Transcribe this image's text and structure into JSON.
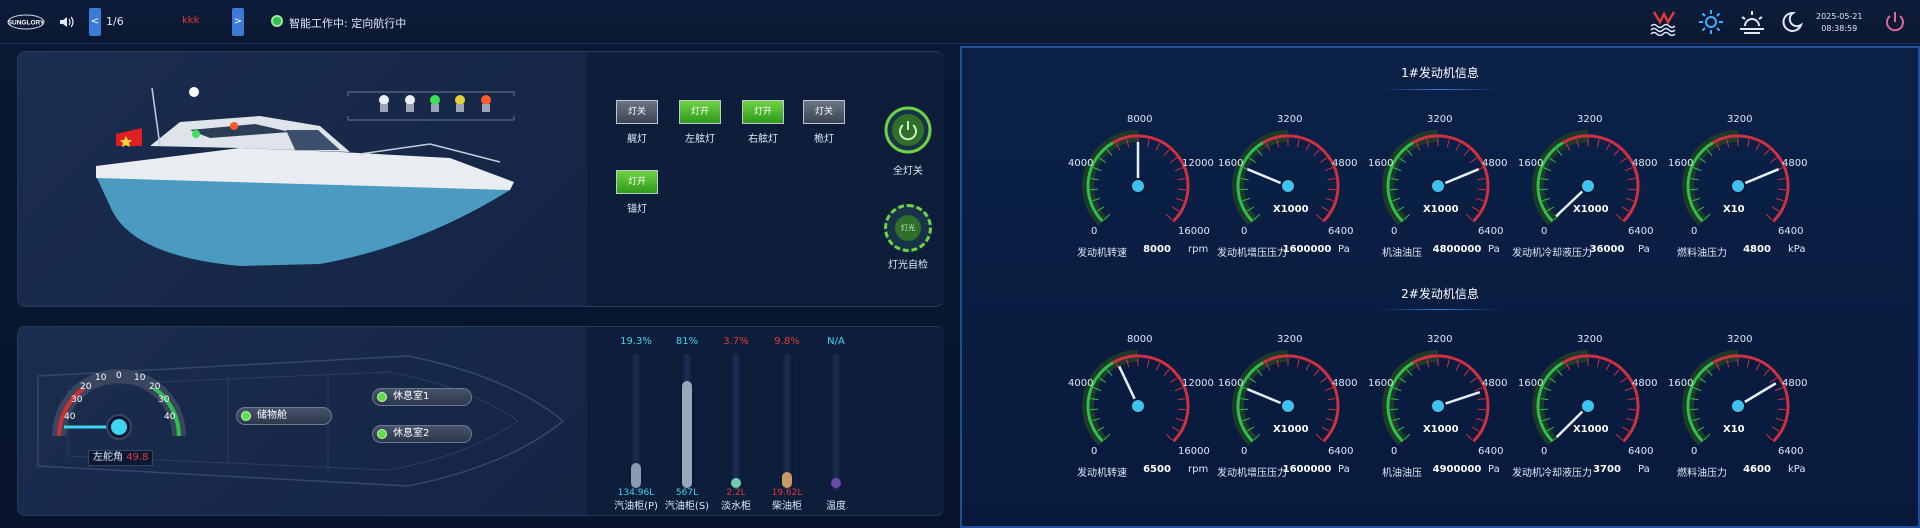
{
  "topbar": {
    "logo_text": "SUNGLORY",
    "page": "1/6",
    "prev_label": "<",
    "next_label": ">",
    "alert_text": "kkk",
    "status_text": "智能工作中: 定向航行中",
    "date": "2025-05-21",
    "time": "08:38:59"
  },
  "lights": {
    "buttons": [
      {
        "state_label": "灯关",
        "label": "艉灯",
        "on": false
      },
      {
        "state_label": "灯开",
        "label": "左舷灯",
        "on": true
      },
      {
        "state_label": "灯开",
        "label": "右舷灯",
        "on": true
      },
      {
        "state_label": "灯关",
        "label": "桅灯",
        "on": false
      },
      {
        "state_label": "灯开",
        "label": "锚灯",
        "on": true
      }
    ],
    "all_off_label": "全灯关",
    "self_check_label": "灯光自检",
    "self_check_inner": "灯光"
  },
  "rudder": {
    "label": "左舵角",
    "value": "49.8",
    "ticks": [
      "40",
      "30",
      "20",
      "10",
      "0",
      "10",
      "20",
      "30",
      "40"
    ]
  },
  "rooms": [
    "储物舱",
    "休息室1",
    "休息室2"
  ],
  "tanks": [
    {
      "pct": "19.3%",
      "value": "134.96L",
      "label": "汽油柜(P)",
      "level": 0.193,
      "pct_color": "#3fd4ef",
      "fill": "#8c9ab0"
    },
    {
      "pct": "81%",
      "value": "567L",
      "label": "汽油柜(S)",
      "level": 0.81,
      "pct_color": "#3fd4ef",
      "fill": "#9aa6ba"
    },
    {
      "pct": "3.7%",
      "value": "2.2L",
      "label": "淡水柜",
      "level": 0.07,
      "pct_color": "#e03a3a",
      "fill": "#6fd0b0"
    },
    {
      "pct": "9.8%",
      "value": "19.62L",
      "label": "柴油柜",
      "level": 0.12,
      "pct_color": "#e03a3a",
      "fill": "#c89a68"
    },
    {
      "pct": "N/A",
      "value": "",
      "label": "温度",
      "level": 0.07,
      "pct_color": "#3fd4ef",
      "fill": "#6a4aa8"
    }
  ],
  "engines": [
    {
      "title": "1#发动机信息",
      "gauges": [
        {
          "label": "发动机转速",
          "value": "8000",
          "unit": "rpm",
          "min": "0",
          "left": "4000",
          "top": "8000",
          "right": "12000",
          "max": "16000",
          "mult": "",
          "reading": 8000,
          "range_max": 16000
        },
        {
          "label": "发动机增压压力",
          "value": "1600000",
          "unit": "Pa",
          "min": "0",
          "left": "1600",
          "top": "3200",
          "right": "4800",
          "max": "6400",
          "mult": "X1000",
          "reading": 1600,
          "range_max": 6400
        },
        {
          "label": "机油油压",
          "value": "4800000",
          "unit": "Pa",
          "min": "0",
          "left": "1600",
          "top": "3200",
          "right": "4800",
          "max": "6400",
          "mult": "X1000",
          "reading": 4800,
          "range_max": 6400
        },
        {
          "label": "发动机冷却液压力",
          "value": "36000",
          "unit": "Pa",
          "min": "0",
          "left": "1600",
          "top": "3200",
          "right": "4800",
          "max": "6400",
          "mult": "X1000",
          "reading": 36,
          "range_max": 6400
        },
        {
          "label": "燃料油压力",
          "value": "4800",
          "unit": "kPa",
          "min": "0",
          "left": "1600",
          "top": "3200",
          "right": "4800",
          "max": "6400",
          "mult": "X10",
          "reading": 4800,
          "range_max": 6400
        }
      ]
    },
    {
      "title": "2#发动机信息",
      "gauges": [
        {
          "label": "发动机转速",
          "value": "6500",
          "unit": "rpm",
          "min": "0",
          "left": "4000",
          "top": "8000",
          "right": "12000",
          "max": "16000",
          "mult": "",
          "reading": 6500,
          "range_max": 16000
        },
        {
          "label": "发动机增压压力",
          "value": "1600000",
          "unit": "Pa",
          "min": "0",
          "left": "1600",
          "top": "3200",
          "right": "4800",
          "max": "6400",
          "mult": "X1000",
          "reading": 1600,
          "range_max": 6400
        },
        {
          "label": "机油油压",
          "value": "4900000",
          "unit": "Pa",
          "min": "0",
          "left": "1600",
          "top": "3200",
          "right": "4800",
          "max": "6400",
          "mult": "X1000",
          "reading": 4900,
          "range_max": 6400
        },
        {
          "label": "发动机冷却液压力",
          "value": "3700",
          "unit": "Pa",
          "min": "0",
          "left": "1600",
          "top": "3200",
          "right": "4800",
          "max": "6400",
          "mult": "X1000",
          "reading": 3.7,
          "range_max": 6400
        },
        {
          "label": "燃料油压力",
          "value": "4600",
          "unit": "kPa",
          "min": "0",
          "left": "1600",
          "top": "3200",
          "right": "4800",
          "max": "6400",
          "mult": "X10",
          "reading": 4600,
          "range_max": 6400
        }
      ]
    }
  ]
}
